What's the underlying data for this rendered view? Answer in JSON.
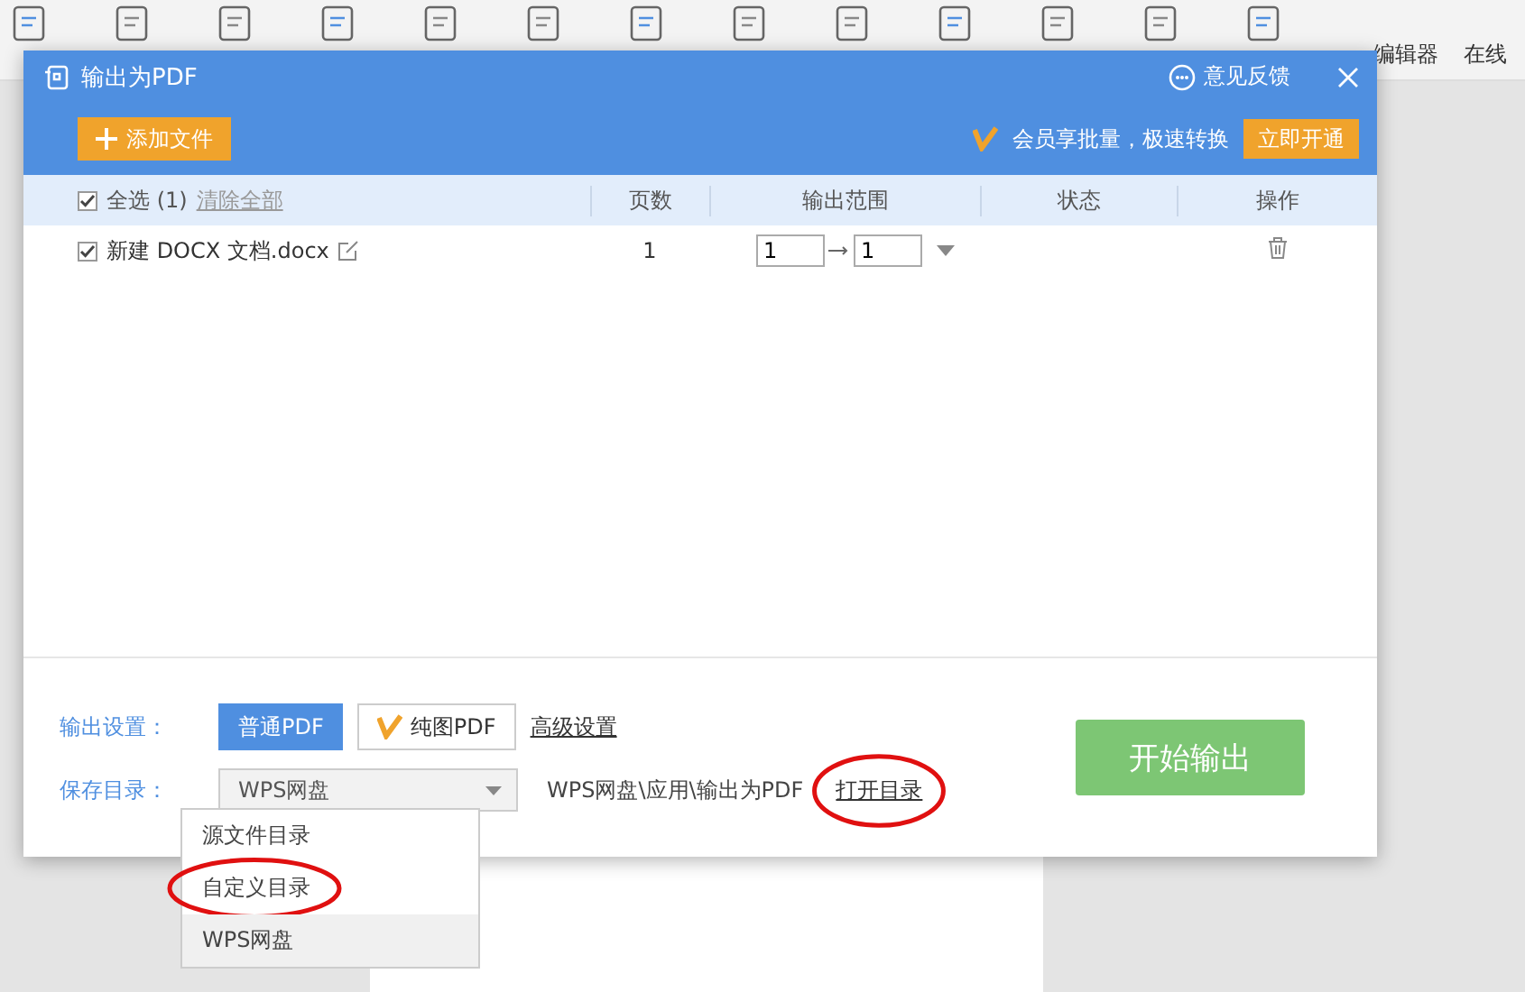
{
  "background_toolbar": {
    "labels": [
      "编辑器",
      "在线"
    ]
  },
  "window": {
    "title": "输出为PDF",
    "feedback": "意见反馈"
  },
  "toolbar": {
    "add_button": "添加文件",
    "promo": "会员享批量，极速转换",
    "promo_button": "立即开通"
  },
  "table": {
    "select_all": {
      "label": "全选 (1)",
      "checked": true
    },
    "clear_all": "清除全部",
    "columns": [
      "页数",
      "输出范围",
      "状态",
      "操作"
    ],
    "rows": [
      {
        "checked": true,
        "name": "新建 DOCX 文档.docx",
        "pages": "1",
        "range_from": "1",
        "range_to": "1"
      }
    ]
  },
  "settings": {
    "output_label": "输出设置：",
    "modes": [
      {
        "label": "普通PDF",
        "selected": true,
        "vip": false
      },
      {
        "label": "纯图PDF",
        "selected": false,
        "vip": true
      }
    ],
    "advanced": "高级设置",
    "save_label": "保存目录：",
    "save_value": "WPS网盘",
    "save_path": "WPS网盘\\应用\\输出为PDF",
    "open_dir": {
      "label": "打开目录",
      "circled": true
    },
    "start_button": "开始输出",
    "dropdown": [
      {
        "label": "源文件目录",
        "selected": false,
        "circled": false
      },
      {
        "label": "自定义目录",
        "selected": false,
        "circled": true
      },
      {
        "label": "WPS网盘",
        "selected": true,
        "circled": false
      }
    ]
  }
}
